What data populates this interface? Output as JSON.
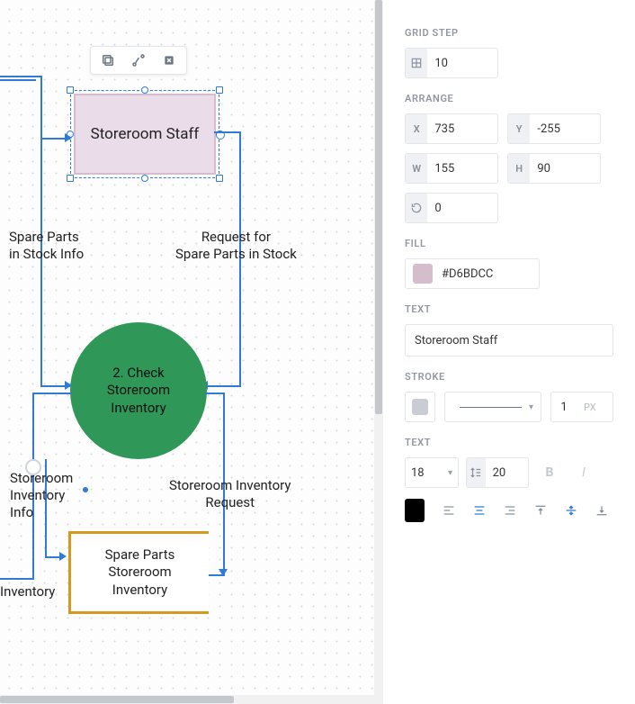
{
  "panel": {
    "grid_step": {
      "head": "GRID STEP",
      "value": "10"
    },
    "arrange": {
      "head": "ARRANGE",
      "x_label": "X",
      "x": "735",
      "y_label": "Y",
      "y": "-255",
      "w_label": "W",
      "w": "155",
      "h_label": "H",
      "h": "90",
      "angle": "0"
    },
    "fill": {
      "head": "FILL",
      "hex": "#D6BDCC"
    },
    "text_field": {
      "head": "TEXT",
      "value": "Storeroom Staff"
    },
    "stroke": {
      "head": "STROKE",
      "width": "1",
      "px": "PX"
    },
    "text_style": {
      "head": "TEXT",
      "size": "18",
      "line_height": "20"
    }
  },
  "canvas": {
    "selected_label": "Storeroom Staff",
    "circle_label_line1": "2. Check",
    "circle_label_line2": "Storeroom",
    "circle_label_line3": "Inventory",
    "store_label_line1": "Spare Parts",
    "store_label_line2": "Storeroom",
    "store_label_line3": "Inventory",
    "lbl_spare_stock1": "Spare Parts",
    "lbl_spare_stock2": "in Stock Info",
    "lbl_request1": "Request for",
    "lbl_request2": "Spare Parts in Stock",
    "lbl_sinv_info1": "Storeroom",
    "lbl_sinv_info2": "Inventory",
    "lbl_sinv_info3": "Info",
    "lbl_sinv_req1": "Storeroom Inventory",
    "lbl_sinv_req2": "Request",
    "lbl_inventory": "Inventory"
  }
}
